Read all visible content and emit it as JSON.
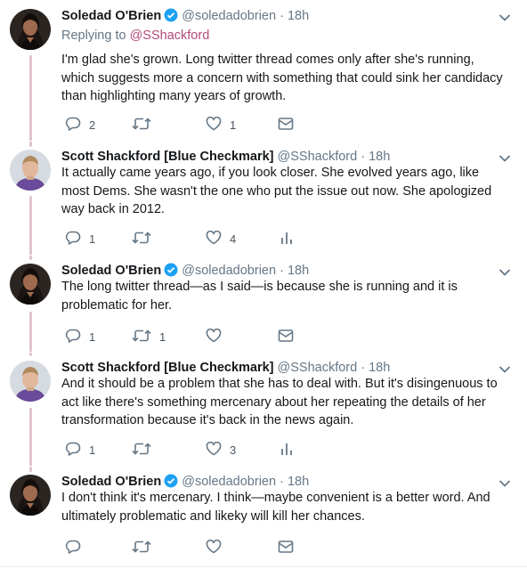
{
  "tweets": [
    {
      "name": "Soledad O'Brien",
      "verified": true,
      "handle": "@soledadobrien",
      "dot": "·",
      "time": "18h",
      "replying_prefix": "Replying to ",
      "replying_to": "@SShackford",
      "text": "I'm glad she's grown. Long twitter thread comes only after she's running, which suggests more a concern with something that could sink her candidacy than highlighting many years of growth.",
      "counts": {
        "replies": "2",
        "retweets": "",
        "likes": "1"
      },
      "has_analytics": false,
      "avatar": "woman-avatar"
    },
    {
      "name": "Scott Shackford [Blue Checkmark]",
      "verified": false,
      "handle": "@SShackford",
      "dot": "·",
      "time": "18h",
      "text": "It actually came years ago, if you look closer. She evolved years ago, like most Dems. She wasn't the one who put the issue out now. She apologized way back in 2012.",
      "counts": {
        "replies": "1",
        "retweets": "",
        "likes": "4"
      },
      "has_analytics": true,
      "avatar": "man-avatar"
    },
    {
      "name": "Soledad O'Brien",
      "verified": true,
      "handle": "@soledadobrien",
      "dot": "·",
      "time": "18h",
      "text": "The long twitter thread—as I said—is because she is running and it is problematic for her.",
      "counts": {
        "replies": "1",
        "retweets": "1",
        "likes": ""
      },
      "has_analytics": false,
      "avatar": "woman-avatar"
    },
    {
      "name": "Scott Shackford [Blue Checkmark]",
      "verified": false,
      "handle": "@SShackford",
      "dot": "·",
      "time": "18h",
      "text": "And it should be a problem that she has to deal with. But it's disingenuous to act like there's something mercenary about her repeating the details of her transformation because it's back in the news again.",
      "counts": {
        "replies": "1",
        "retweets": "",
        "likes": "3"
      },
      "has_analytics": true,
      "avatar": "man-avatar"
    },
    {
      "name": "Soledad O'Brien",
      "verified": true,
      "handle": "@soledadobrien",
      "dot": "·",
      "time": "18h",
      "text": "I don't think it's mercenary. I think—maybe convenient is a better word. And ultimately problematic and likeky will kill her chances.",
      "counts": {
        "replies": "",
        "retweets": "",
        "likes": ""
      },
      "has_analytics": false,
      "avatar": "woman-avatar"
    }
  ],
  "colors": {
    "accent": "#1da1f2",
    "thread_line": "#e1c4cf",
    "muted": "#657786",
    "link": "#b24a7a"
  },
  "icons": [
    "reply-icon",
    "retweet-icon",
    "like-icon",
    "message-icon",
    "analytics-icon",
    "verified-icon",
    "chevron-down-icon"
  ]
}
